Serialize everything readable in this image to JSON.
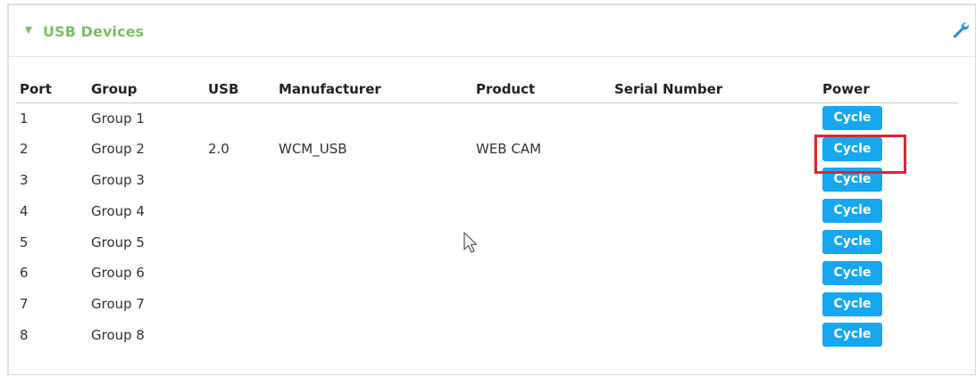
{
  "panel": {
    "title": "USB Devices",
    "collapse_icon": "triangle-down-icon",
    "settings_icon": "wrench-icon"
  },
  "colors": {
    "title_green": "#7cbf63",
    "button_blue": "#16a7f0",
    "highlight_red": "#e0242f",
    "wrench_blue": "#1c96e0"
  },
  "table": {
    "headers": {
      "port": "Port",
      "group": "Group",
      "usb": "USB",
      "manufacturer": "Manufacturer",
      "product": "Product",
      "serial": "Serial Number",
      "power": "Power"
    },
    "rows": [
      {
        "port": "1",
        "group": "Group 1",
        "usb": "",
        "manufacturer": "",
        "product": "",
        "serial": "",
        "power": "Cycle"
      },
      {
        "port": "2",
        "group": "Group 2",
        "usb": "2.0",
        "manufacturer": "WCM_USB",
        "product": "WEB CAM",
        "serial": "",
        "power": "Cycle"
      },
      {
        "port": "3",
        "group": "Group 3",
        "usb": "",
        "manufacturer": "",
        "product": "",
        "serial": "",
        "power": "Cycle"
      },
      {
        "port": "4",
        "group": "Group 4",
        "usb": "",
        "manufacturer": "",
        "product": "",
        "serial": "",
        "power": "Cycle"
      },
      {
        "port": "5",
        "group": "Group 5",
        "usb": "",
        "manufacturer": "",
        "product": "",
        "serial": "",
        "power": "Cycle"
      },
      {
        "port": "6",
        "group": "Group 6",
        "usb": "",
        "manufacturer": "",
        "product": "",
        "serial": "",
        "power": "Cycle"
      },
      {
        "port": "7",
        "group": "Group 7",
        "usb": "",
        "manufacturer": "",
        "product": "",
        "serial": "",
        "power": "Cycle"
      },
      {
        "port": "8",
        "group": "Group 8",
        "usb": "",
        "manufacturer": "",
        "product": "",
        "serial": "",
        "power": "Cycle"
      }
    ]
  }
}
